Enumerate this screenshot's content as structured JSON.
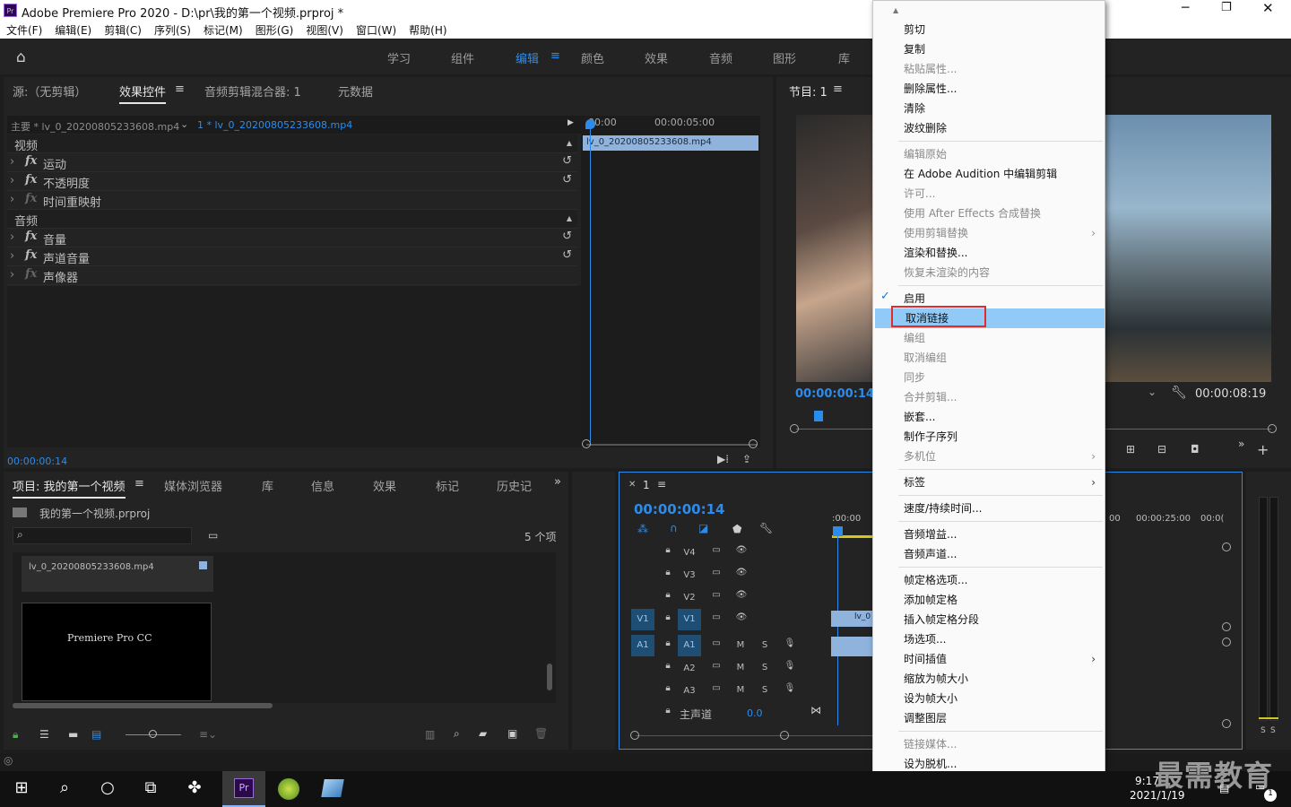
{
  "window": {
    "title": "Adobe Premiere Pro 2020 - D:\\pr\\我的第一个视频.prproj *",
    "app_icon": "Pr"
  },
  "menu": [
    "文件(F)",
    "编辑(E)",
    "剪辑(C)",
    "序列(S)",
    "标记(M)",
    "图形(G)",
    "视图(V)",
    "窗口(W)",
    "帮助(H)"
  ],
  "workspaces": [
    "学习",
    "组件",
    "编辑",
    "颜色",
    "效果",
    "音频",
    "图形",
    "库"
  ],
  "source_panel": {
    "tabs": [
      "源:（无剪辑）",
      "效果控件",
      "音频剪辑混合器: 1",
      "元数据"
    ],
    "master_label": "主要 * lv_0_20200805233608.mp4",
    "seq_label": "1 * lv_0_20200805233608.mp4",
    "ruler": [
      "00:00",
      "00:00:05:00"
    ],
    "clip": "lv_0_20200805233608.mp4",
    "video_header": "视频",
    "audio_header": "音频",
    "effects": [
      "运动",
      "不透明度",
      "时间重映射",
      "音量",
      "声道音量",
      "声像器"
    ],
    "timecode": "00:00:00:14"
  },
  "program_panel": {
    "title": "节目: 1",
    "timecode": "00:00:00:14",
    "duration": "00:00:08:19"
  },
  "project_panel": {
    "tabs": [
      "项目: 我的第一个视频",
      "媒体浏览器",
      "库",
      "信息",
      "效果",
      "标记",
      "历史记"
    ],
    "file": "我的第一个视频.prproj",
    "count": "5 个项",
    "item1": "lv_0_20200805233608.mp4",
    "item2": "Premiere Pro CC"
  },
  "timeline": {
    "seq": "1",
    "timecode": "00:00:00:14",
    "ruler": [
      ":00:00",
      "00",
      "00:00:25:00",
      "00:0("
    ],
    "video_tracks": [
      "V4",
      "V3",
      "V2",
      "V1"
    ],
    "audio_tracks": [
      "A1",
      "A2",
      "A3"
    ],
    "master": "主声道",
    "master_val": "0.0",
    "clip": "lv_0"
  },
  "context_menu": {
    "items": [
      {
        "label": "剪切",
        "enabled": true
      },
      {
        "label": "复制",
        "enabled": true
      },
      {
        "label": "粘贴属性...",
        "enabled": false
      },
      {
        "label": "删除属性...",
        "enabled": true
      },
      {
        "label": "清除",
        "enabled": true
      },
      {
        "label": "波纹删除",
        "enabled": true
      },
      {
        "label": "编辑原始",
        "enabled": false
      },
      {
        "label": "在 Adobe Audition 中编辑剪辑",
        "enabled": true
      },
      {
        "label": "许可...",
        "enabled": false
      },
      {
        "label": "使用 After Effects 合成替换",
        "enabled": false
      },
      {
        "label": "使用剪辑替换",
        "enabled": false
      },
      {
        "label": "渲染和替换...",
        "enabled": true
      },
      {
        "label": "恢复未渲染的内容",
        "enabled": false
      },
      {
        "label": "启用",
        "enabled": true
      },
      {
        "label": "取消链接",
        "enabled": true
      },
      {
        "label": "编组",
        "enabled": false
      },
      {
        "label": "取消编组",
        "enabled": false
      },
      {
        "label": "同步",
        "enabled": false
      },
      {
        "label": "合并剪辑...",
        "enabled": false
      },
      {
        "label": "嵌套...",
        "enabled": true
      },
      {
        "label": "制作子序列",
        "enabled": true
      },
      {
        "label": "多机位",
        "enabled": false
      },
      {
        "label": "标签",
        "enabled": true
      },
      {
        "label": "速度/持续时间...",
        "enabled": true
      },
      {
        "label": "音频增益...",
        "enabled": true
      },
      {
        "label": "音频声道...",
        "enabled": true
      },
      {
        "label": "帧定格选项...",
        "enabled": true
      },
      {
        "label": "添加帧定格",
        "enabled": true
      },
      {
        "label": "插入帧定格分段",
        "enabled": true
      },
      {
        "label": "场选项...",
        "enabled": true
      },
      {
        "label": "时间插值",
        "enabled": true
      },
      {
        "label": "缩放为帧大小",
        "enabled": true
      },
      {
        "label": "设为帧大小",
        "enabled": true
      },
      {
        "label": "调整图层",
        "enabled": true
      },
      {
        "label": "链接媒体...",
        "enabled": false
      },
      {
        "label": "设为脱机...",
        "enabled": true
      }
    ]
  },
  "taskbar": {
    "time": "9:17",
    "date": "2021/1/19",
    "notif": "1"
  },
  "watermark": "最需教育"
}
